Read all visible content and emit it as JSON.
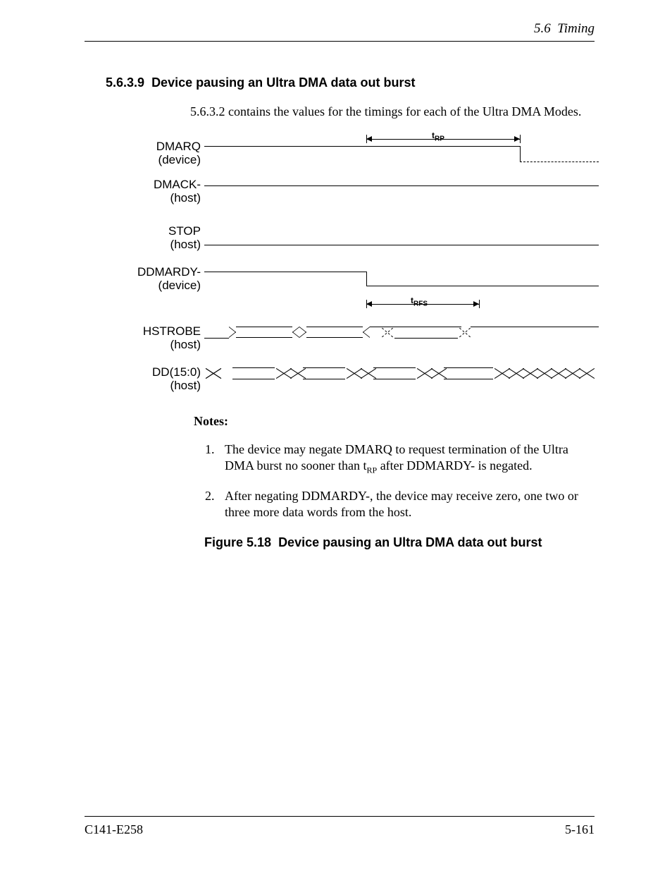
{
  "header": {
    "section_ref": "5.6",
    "section_title": "Timing"
  },
  "section": {
    "number": "5.6.3.9",
    "title": "Device pausing an Ultra DMA data out burst",
    "intro": "5.6.3.2 contains the values for the timings for each of the Ultra DMA Modes."
  },
  "signals": [
    {
      "name": "DMARQ",
      "src": "(device)"
    },
    {
      "name": "DMACK-",
      "src": "(host)"
    },
    {
      "name": "STOP",
      "src": "(host)"
    },
    {
      "name": "DDMARDY-",
      "src": "(device)"
    },
    {
      "name": "HSTROBE",
      "src": "(host)"
    },
    {
      "name": "DD(15:0)",
      "src": "(host)"
    }
  ],
  "timing_labels": {
    "trp": "RP",
    "trfs": "RFS"
  },
  "notes": {
    "heading": "Notes:",
    "items": [
      "The device may negate DMARQ to request termination of the Ultra DMA burst no sooner than t__RP__ after DDMARDY- is negated.",
      "After negating DDMARDY-, the device may receive zero, one two or three more data words from the host."
    ]
  },
  "figure": {
    "label": "Figure 5.18",
    "caption": "Device pausing an Ultra DMA data out burst"
  },
  "footer": {
    "doc_id": "C141-E258",
    "page": "5-161"
  }
}
